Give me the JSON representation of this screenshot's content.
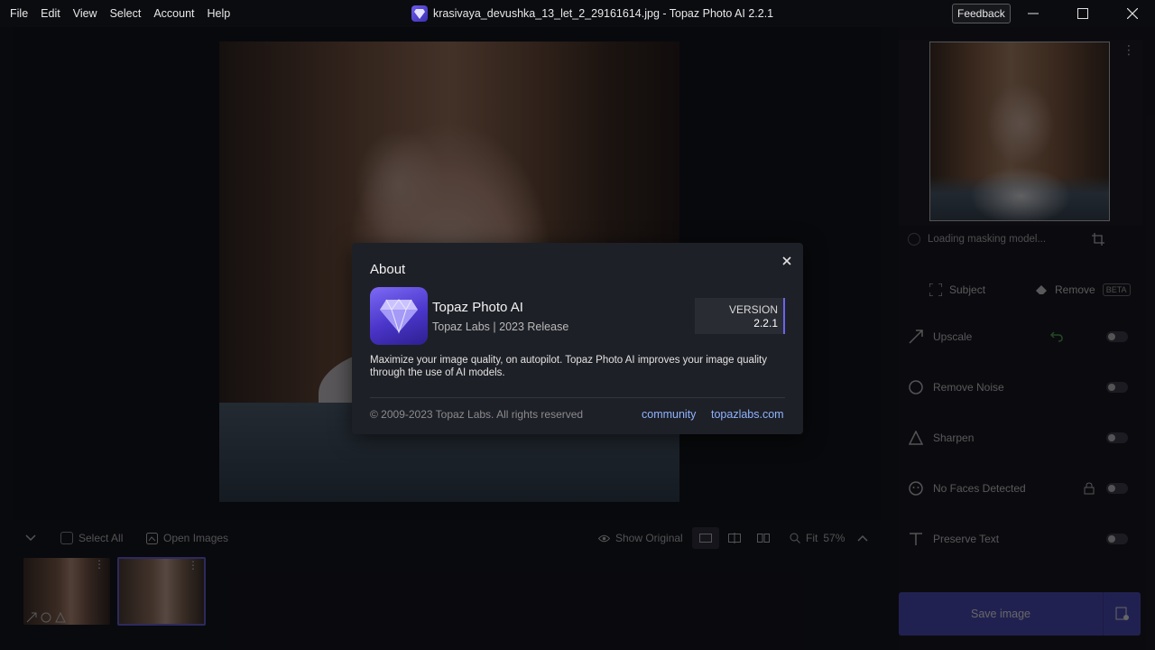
{
  "menu": [
    "File",
    "Edit",
    "View",
    "Select",
    "Account",
    "Help"
  ],
  "window": {
    "title": "krasivaya_devushka_13_let_2_29161614.jpg - Topaz Photo AI 2.2.1",
    "feedback_label": "Feedback"
  },
  "bottom_bar": {
    "select_all": "Select All",
    "open_images": "Open Images",
    "show_original": "Show Original",
    "fit_label": "Fit",
    "zoom": "57%"
  },
  "right_panel": {
    "loading_text": "Loading masking model...",
    "subject_label": "Subject",
    "remove_label": "Remove",
    "beta_label": "BETA",
    "tools": [
      {
        "label": "Upscale",
        "icon": "upscale-icon"
      },
      {
        "label": "Remove Noise",
        "icon": "remove-noise-icon"
      },
      {
        "label": "Sharpen",
        "icon": "sharpen-icon"
      },
      {
        "label": "No Faces Detected",
        "icon": "face-icon"
      },
      {
        "label": "Preserve Text",
        "icon": "text-icon"
      }
    ],
    "save_label": "Save image"
  },
  "about": {
    "title": "About",
    "app_name": "Topaz Photo AI",
    "app_sub": "Topaz Labs | 2023 Release",
    "version_label": "VERSION",
    "version": "2.2.1",
    "description": "Maximize your image quality, on autopilot. Topaz Photo AI improves your image quality through the use of AI models.",
    "copyright": "© 2009-2023 Topaz Labs. All rights reserved",
    "link_community": "community",
    "link_site": "topazlabs.com"
  },
  "colors": {
    "accent": "#6b63ef",
    "link": "#8fb3ff",
    "save_button": "#4b4ac2"
  }
}
